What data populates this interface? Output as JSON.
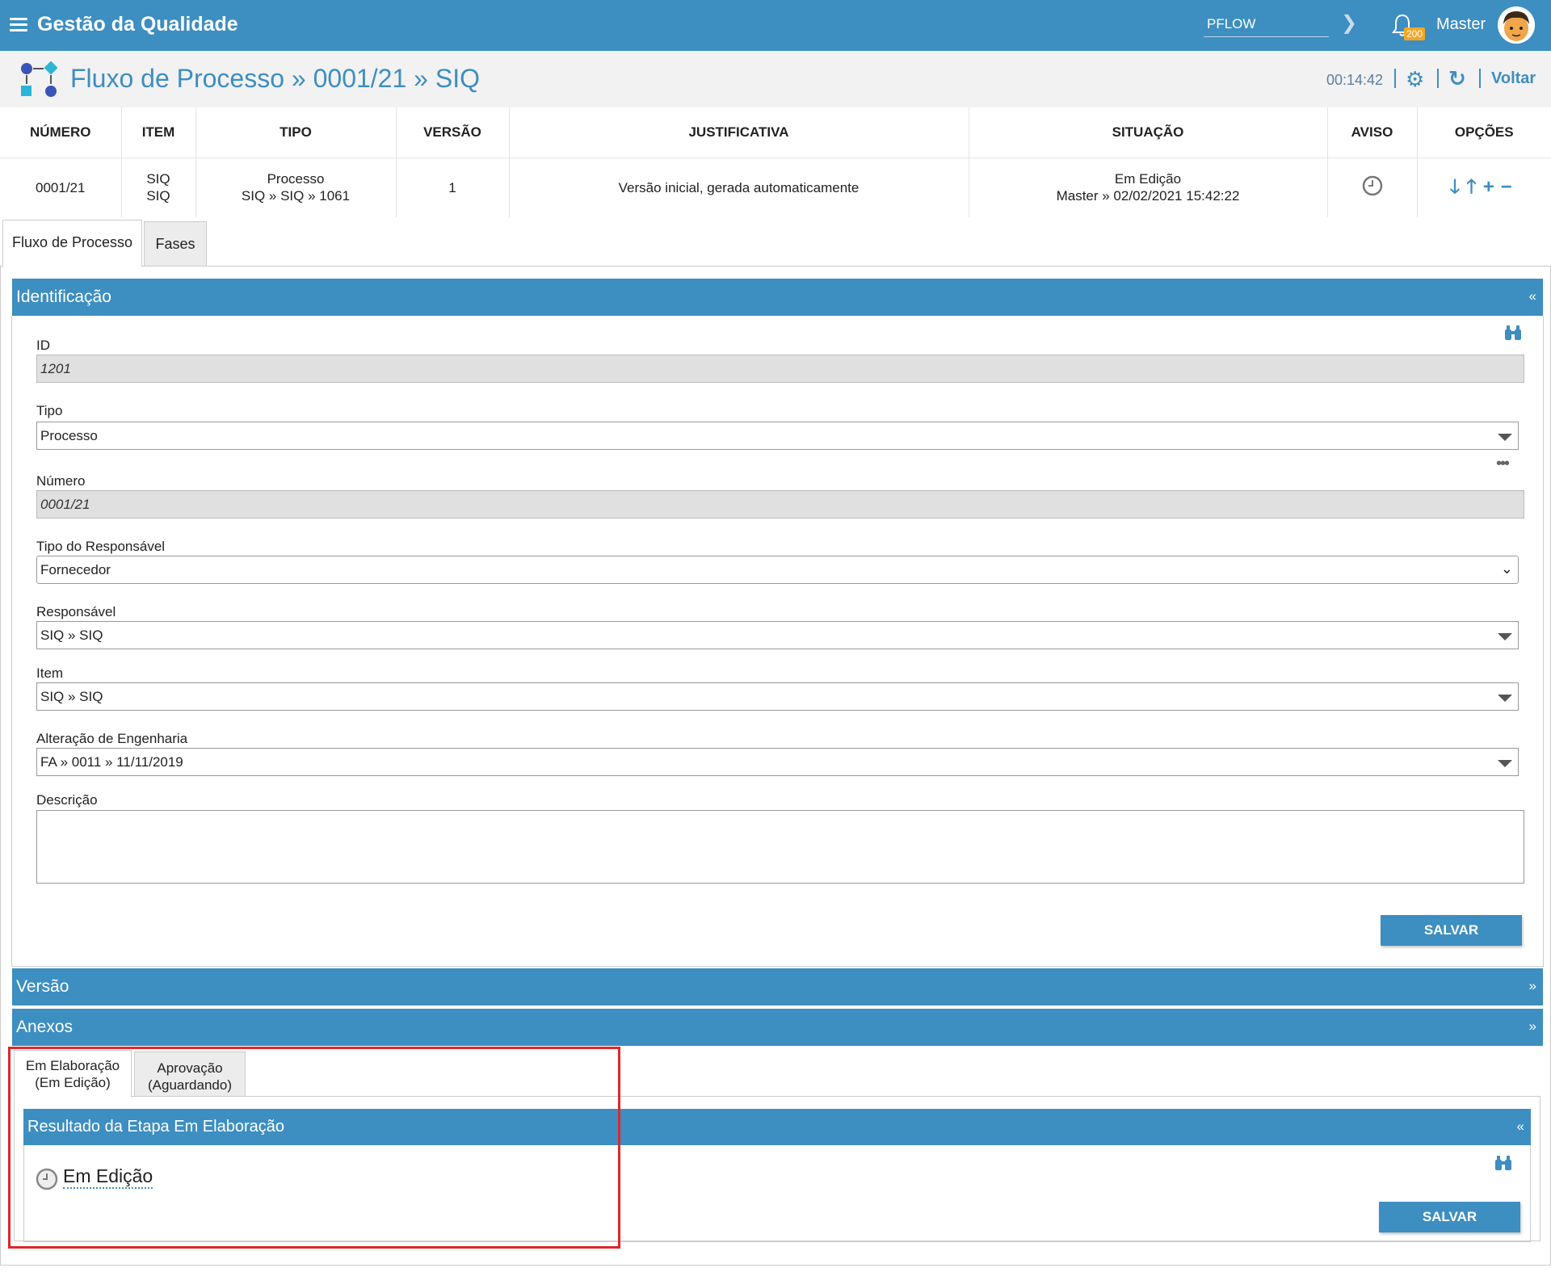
{
  "topbar": {
    "app_title": "Gestão da Qualidade",
    "search_value": "PFLOW",
    "notification_count": "200",
    "user_name": "Master",
    "bg_color": "#3d8ec1"
  },
  "header": {
    "title": "Fluxo de Processo » 0001/21 » SIQ",
    "time": "00:14:42",
    "back_label": "Voltar"
  },
  "table": {
    "columns": [
      "NÚMERO",
      "ITEM",
      "TIPO",
      "VERSÃO",
      "JUSTIFICATIVA",
      "SITUAÇÃO",
      "AVISO",
      "OPÇÕES"
    ],
    "row": {
      "numero": "0001/21",
      "item_1": "SIQ",
      "item_2": "SIQ",
      "tipo_1": "Processo",
      "tipo_2": "SIQ » SIQ » 1061",
      "versao": "1",
      "justificativa": "Versão inicial, gerada automaticamente",
      "situacao_1": "Em Edição",
      "situacao_2": "Master » 02/02/2021 15:42:22"
    }
  },
  "tabs": [
    "Fluxo de Processo",
    "Fases"
  ],
  "identificacao": {
    "title": "Identificação",
    "fields": {
      "id_label": "ID",
      "id_value": "1201",
      "tipo_label": "Tipo",
      "tipo_value": "Processo",
      "numero_label": "Número",
      "numero_value": "0001/21",
      "tipo_resp_label": "Tipo do Responsável",
      "tipo_resp_value": "Fornecedor",
      "responsavel_label": "Responsável",
      "responsavel_value": "SIQ » SIQ",
      "item_label": "Item",
      "item_value": "SIQ » SIQ",
      "alteracao_label": "Alteração de Engenharia",
      "alteracao_value": "FA » 0011 » 11/11/2019",
      "descricao_label": "Descrição"
    },
    "save_label": "SALVAR"
  },
  "versao_section": "Versão",
  "anexos_section": "Anexos",
  "stage_tabs": {
    "tab1_line1": "Em Elaboração",
    "tab1_line2": "(Em Edição)",
    "tab2_line1": "Aprovação",
    "tab2_line2": "(Aguardando)"
  },
  "resultado": {
    "title": "Resultado da Etapa Em Elaboração",
    "status": "Em Edição",
    "save_label": "SALVAR"
  }
}
